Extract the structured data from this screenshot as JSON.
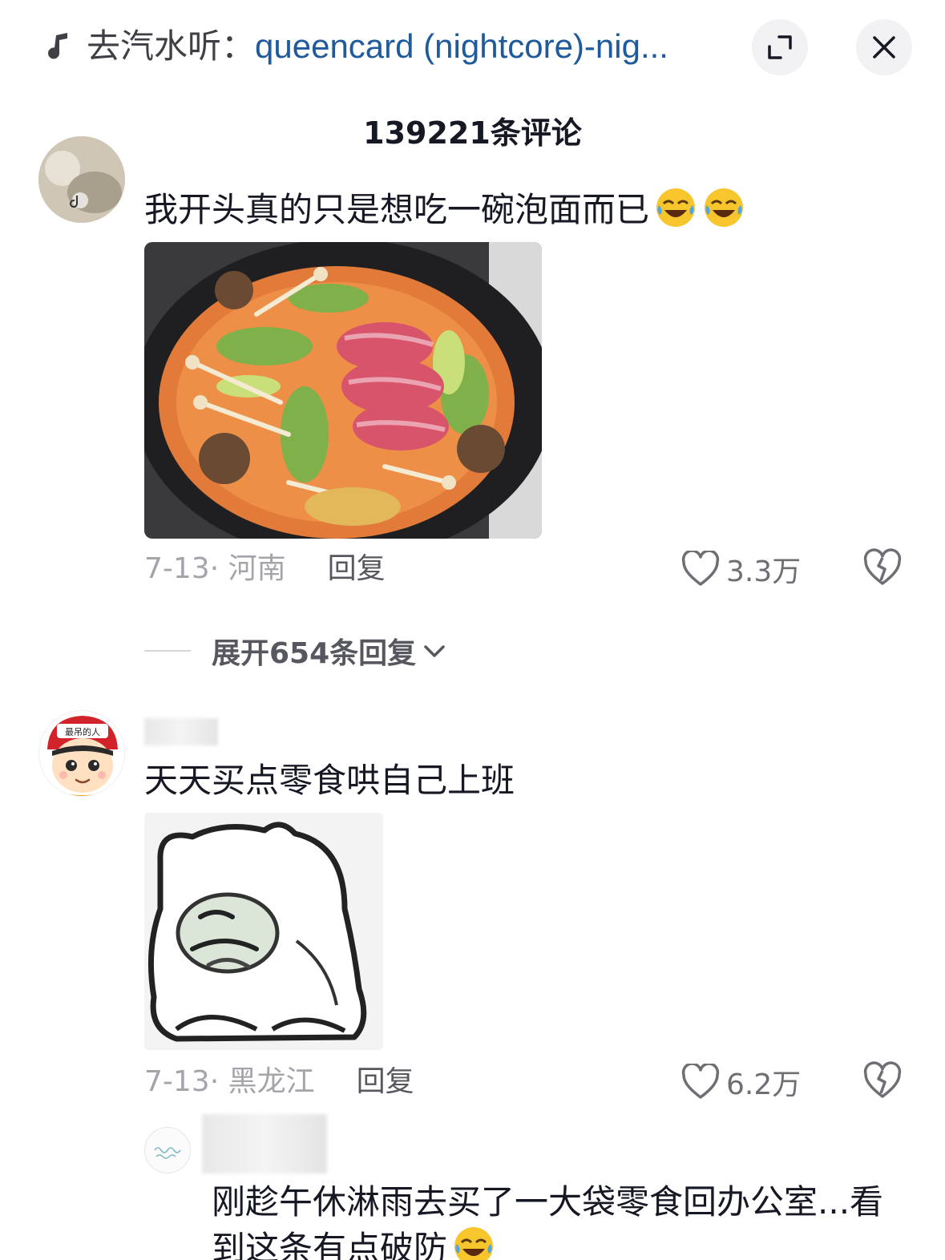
{
  "header": {
    "music_prefix": "去汽水听：",
    "music_title": "queencard (nightcore)-nig...",
    "icons": [
      "music-note-icon",
      "minimize-icon",
      "close-icon"
    ]
  },
  "comments_header": {
    "count_label": "139221条评论"
  },
  "comments": [
    {
      "text": "我开头真的只是想吃一碗泡面而已",
      "emoji": [
        "rofl-emoji",
        "rofl-emoji"
      ],
      "image": "hotpot-noodles-photo",
      "date": "7-13",
      "location": "· 河南",
      "reply_label": "回复",
      "likes": "3.3万",
      "expand_label": "展开654条回复"
    },
    {
      "avatar_badge": "最吊的人",
      "text": "天天买点零食哄自己上班",
      "image": "crying-cat-sticker",
      "date": "7-13",
      "location": "· 黑龙江",
      "reply_label": "回复",
      "likes": "6.2万"
    }
  ],
  "reply": {
    "text": "刚趁午休淋雨去买了一大袋零食回办公室...看到这条有点破防",
    "emoji": [
      "rofl-emoji"
    ]
  },
  "colors": {
    "music_title": "#1e5a9c",
    "meta_gray": "#a4a5ab",
    "text": "#161823"
  }
}
